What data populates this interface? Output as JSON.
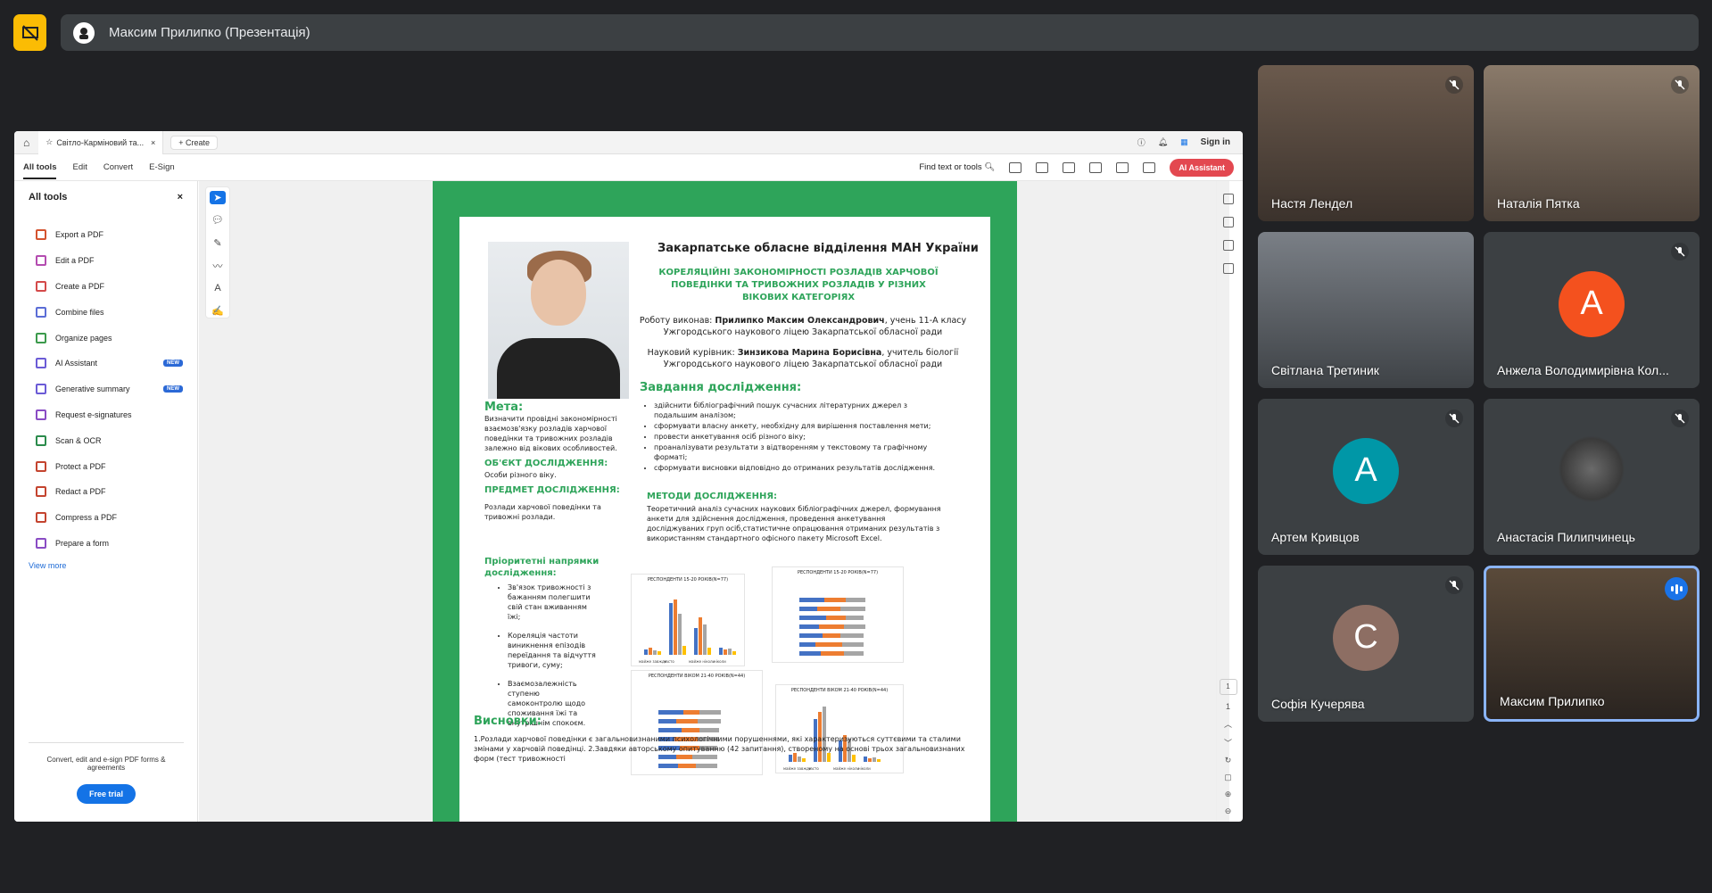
{
  "meeting": {
    "presentation_title": "Максим Прилипко (Презентація)"
  },
  "browser": {
    "tab_title": "Світло-Карміновий та...",
    "new_tab_label": "Create",
    "sign_in": "Sign in"
  },
  "acrobat": {
    "menu": [
      "All tools",
      "Edit",
      "Convert",
      "E-Sign"
    ],
    "find_label": "Find text or tools",
    "ai_button": "AI Assistant",
    "sidebar": {
      "title": "All tools",
      "items": [
        {
          "label": "Export a PDF",
          "badge": ""
        },
        {
          "label": "Edit a PDF",
          "badge": ""
        },
        {
          "label": "Create a PDF",
          "badge": ""
        },
        {
          "label": "Combine files",
          "badge": ""
        },
        {
          "label": "Organize pages",
          "badge": ""
        },
        {
          "label": "AI Assistant",
          "badge": "NEW"
        },
        {
          "label": "Generative summary",
          "badge": "NEW"
        },
        {
          "label": "Request e-signatures",
          "badge": ""
        },
        {
          "label": "Scan & OCR",
          "badge": ""
        },
        {
          "label": "Protect a PDF",
          "badge": ""
        },
        {
          "label": "Redact a PDF",
          "badge": ""
        },
        {
          "label": "Compress a PDF",
          "badge": ""
        },
        {
          "label": "Prepare a form",
          "badge": ""
        }
      ],
      "view_more": "View more",
      "footer_text": "Convert, edit and e-sign PDF forms & agreements",
      "trial_button": "Free trial"
    },
    "page_current": "1",
    "page_total": "1"
  },
  "poster": {
    "org": "Закарпатське обласне відділення МАН України",
    "project_title": "КОРЕЛЯЦІЙНІ ЗАКОНОМІРНОСТІ РОЗЛАДІВ ХАРЧОВОЇ ПОВЕДІНКИ ТА ТРИВОЖНИХ РОЗЛАДІВ У РІЗНИХ ВІКОВИХ КАТЕГОРІЯХ",
    "author_label": "Роботу виконав:",
    "author_name": "Прилипко Максим Олександрович",
    "author_rest": ", учень 11-А класу Ужгородського наукового ліцею Закарпатської обласної ради",
    "supervisor_label": "Науковий курівник:",
    "supervisor_name": "Зинзикова Марина Борисівна",
    "supervisor_rest": ", учитель біології Ужгородського наукового ліцею Закарпатської обласної ради",
    "tasks_heading": "Завдання дослідження:",
    "tasks": [
      "здійснити бібліографічний пошук сучасних літературних джерел з подальшим аналізом;",
      "сформувати власну анкету, необхідну для вирішення поставлення мети;",
      "провести анкетування осіб різного віку;",
      "проаналізувати результати з відтворенням у текстовому та графічному форматі;",
      "сформувати висновки відповідно до отриманих результатів дослідження."
    ],
    "methods_heading": "МЕТОДИ ДОСЛІДЖЕННЯ:",
    "methods_text": "Теоретичний аналіз сучасних наукових бібліографічних джерел, формування анкети для здійснення дослідження, проведення анкетування досліджуваних груп осіб,статистичне опрацювання отриманих результатів з використанням стандартного офісного пакету Microsoft Excel.",
    "goal_heading": "Мета:",
    "goal_text": "Визначити провідні закономірності взаємозв'язку розладів харчової поведінки та тривожних розладів залежно від вікових особливостей.",
    "object_heading": "ОБ'ЄКТ ДОСЛІДЖЕННЯ:",
    "object_text": "Особи різного віку.",
    "subject_heading": "ПРЕДМЕТ ДОСЛІДЖЕННЯ:",
    "subject_text": "Розлади харчової поведінки та тривожні розлади.",
    "priority_heading": "Пріоритетні напрямки дослідження:",
    "priority": [
      "Зв'язок тривожності з бажанням полегшити свій стан вживанням їжі;",
      "Кореляція частоти виникнення епізодів переїдання та відчуття тривоги, суму;",
      "Взаємозалежність ступеню самоконтролю щодо споживання їжі та внутрішнім спокоєм."
    ],
    "chart1_title": "РЕСПОНДЕНТИ 15-20 РОКІВ(N=77)",
    "chart2_title": "РЕСПОНДЕНТИ 15-20 РОКІВ(N=77)",
    "chart3_title": "РЕСПОНДЕНТИ ВІКОМ 21-40 РОКІВ(N=44)",
    "chart4_title": "РЕСПОНДЕНТИ ВІКОМ 21-40 РОКІВ(N=44)",
    "chart_x_labels": [
      "майже завжди",
      "часто",
      "майже ніколи",
      "ніколи"
    ],
    "conclusions_heading": "Висновки:",
    "conclusions": "1.Розлади харчової поведінки є загальновизнаними психологічними порушеннями, які характеризуються суттєвими та сталими змінами у харчовій поведінці. 2.Завдяки авторському опитуванню (42 запитання), створеному на основі трьох загальновизнаних форм (тест тривожності"
  },
  "participants": [
    {
      "name": "Настя Лендел",
      "muted": true,
      "avatar": "",
      "color": ""
    },
    {
      "name": "Наталія Пятка",
      "muted": true,
      "avatar": "",
      "color": ""
    },
    {
      "name": "Світлана Третиник",
      "muted": false,
      "avatar": "",
      "color": ""
    },
    {
      "name": "Анжела Володимирівна Кол...",
      "muted": true,
      "avatar": "A",
      "color": "#f4511e"
    },
    {
      "name": "Артем Кривцов",
      "muted": true,
      "avatar": "A",
      "color": "#0097a7"
    },
    {
      "name": "Анастасія Пилипчинець",
      "muted": true,
      "avatar": "",
      "color": ""
    },
    {
      "name": "Софія Кучерява",
      "muted": true,
      "avatar": "C",
      "color": "#8d6e63"
    },
    {
      "name": "Максим Прилипко",
      "muted": false,
      "avatar": "",
      "color": ""
    }
  ],
  "colors": {
    "accent": "#2ea45a",
    "meet_bg": "#202124",
    "tile_bg": "#3c4043",
    "ai_red": "#e34850"
  }
}
